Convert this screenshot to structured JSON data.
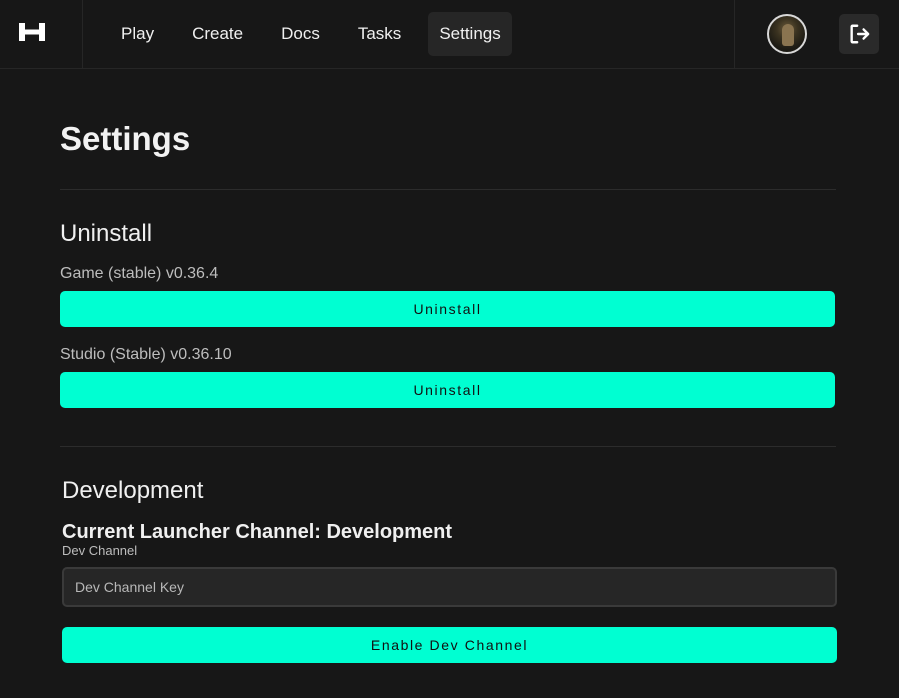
{
  "nav": {
    "logo_icon": "hytale-h-logo",
    "items": [
      {
        "label": "Play",
        "active": false
      },
      {
        "label": "Create",
        "active": false
      },
      {
        "label": "Docs",
        "active": false
      },
      {
        "label": "Tasks",
        "active": false
      },
      {
        "label": "Settings",
        "active": true
      }
    ],
    "avatar_icon": "user-avatar",
    "logout_icon": "logout-icon"
  },
  "page": {
    "title": "Settings"
  },
  "uninstall": {
    "title": "Uninstall",
    "items": [
      {
        "label": "Game (stable) v0.36.4",
        "button": "Uninstall"
      },
      {
        "label": "Studio (Stable) v0.36.10",
        "button": "Uninstall"
      }
    ]
  },
  "development": {
    "title": "Development",
    "channel_heading": "Current Launcher Channel: Development",
    "field_label": "Dev Channel",
    "input_placeholder": "Dev Channel Key",
    "input_value": "",
    "button": "Enable Dev Channel"
  },
  "colors": {
    "background": "#171717",
    "accent": "#00ffd2",
    "nav_active": "#262626"
  }
}
